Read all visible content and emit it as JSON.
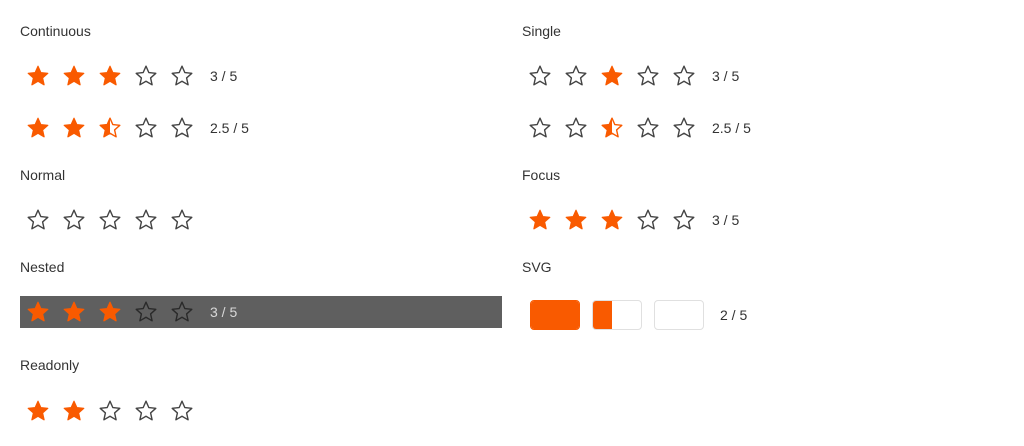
{
  "accent_color": "#f95a00",
  "empty_stroke": "#444444",
  "sections": {
    "continuous": {
      "title": "Continuous",
      "rows": [
        {
          "value": 3,
          "label": "3 / 5"
        },
        {
          "value": 2.5,
          "label": "2.5 / 5"
        }
      ]
    },
    "single": {
      "title": "Single",
      "rows": [
        {
          "selected_index": 3,
          "fill": 1,
          "label": "3 / 5"
        },
        {
          "selected_index": 3,
          "fill": 0.5,
          "label": "2.5 / 5"
        }
      ]
    },
    "normal": {
      "title": "Normal",
      "value": 0
    },
    "focus": {
      "title": "Focus",
      "value": 3,
      "label": "3 / 5"
    },
    "nested": {
      "title": "Nested",
      "value": 3,
      "label": "3 / 5"
    },
    "svg": {
      "title": "SVG",
      "fills": [
        1,
        0.4,
        0
      ],
      "label": "2 / 5"
    },
    "readonly": {
      "title": "Readonly",
      "value": 2
    }
  }
}
